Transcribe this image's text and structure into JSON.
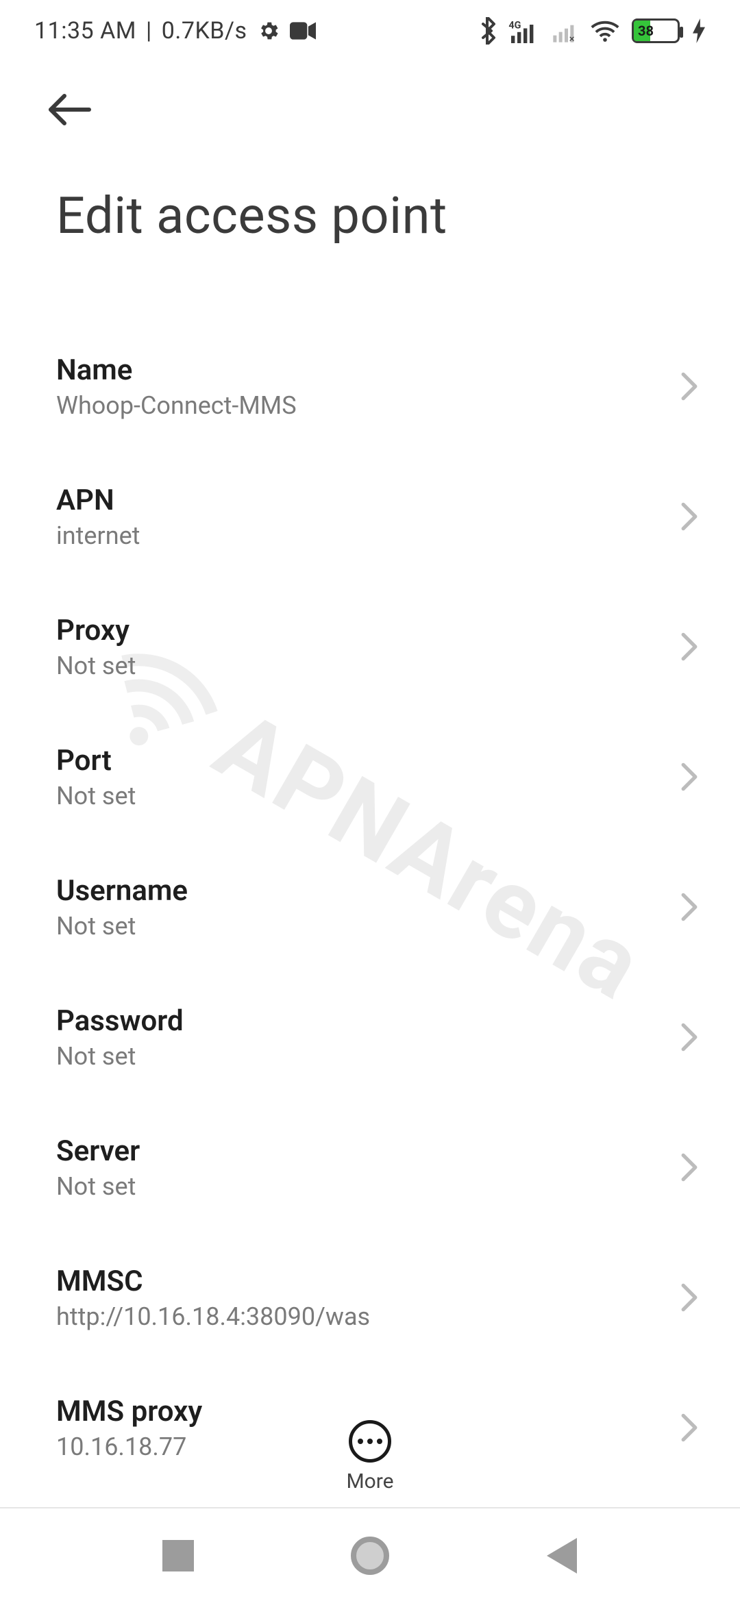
{
  "status": {
    "time": "11:35 AM",
    "sep": "|",
    "rate": "0.7KB/s",
    "battery_pct": "38"
  },
  "header": {
    "title": "Edit access point"
  },
  "rows": [
    {
      "label": "Name",
      "value": "Whoop-Connect-MMS"
    },
    {
      "label": "APN",
      "value": "internet"
    },
    {
      "label": "Proxy",
      "value": "Not set"
    },
    {
      "label": "Port",
      "value": "Not set"
    },
    {
      "label": "Username",
      "value": "Not set"
    },
    {
      "label": "Password",
      "value": "Not set"
    },
    {
      "label": "Server",
      "value": "Not set"
    },
    {
      "label": "MMSC",
      "value": "http://10.16.18.4:38090/was"
    },
    {
      "label": "MMS proxy",
      "value": "10.16.18.77"
    }
  ],
  "more": {
    "label": "More"
  },
  "watermark": "APNArena"
}
